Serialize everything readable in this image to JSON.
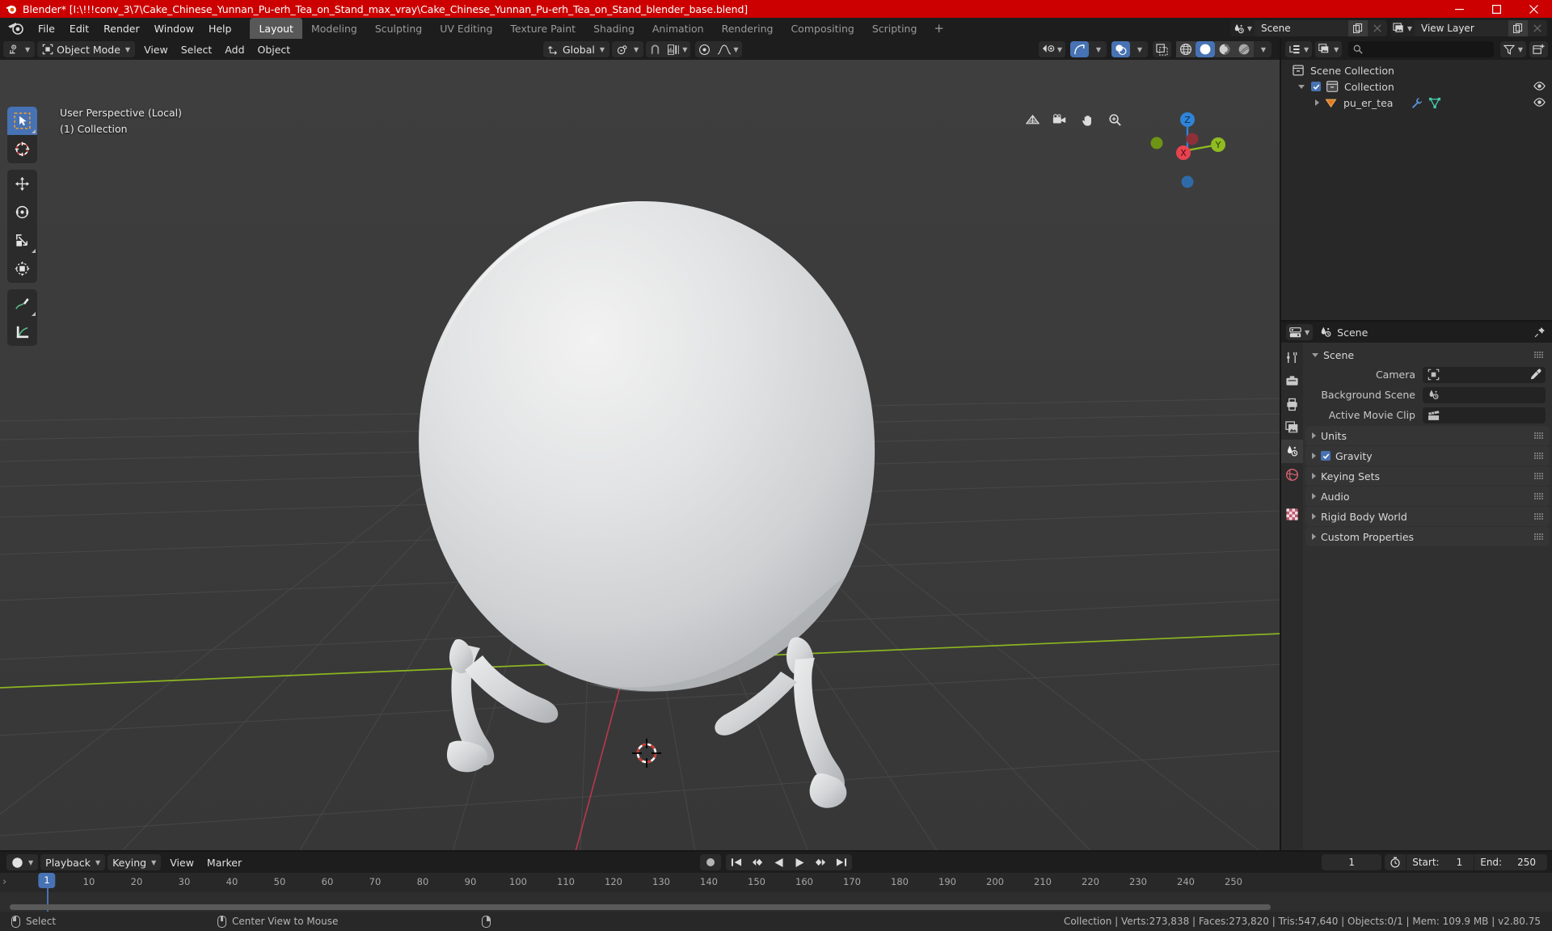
{
  "window": {
    "app_name": "Blender*",
    "title": "Blender* [I:\\!!!conv_3\\7\\Cake_Chinese_Yunnan_Pu-erh_Tea_on_Stand_max_vray\\Cake_Chinese_Yunnan_Pu-erh_Tea_on_Stand_blender_base.blend]",
    "titlebar_color": "#cc0000",
    "controls": {
      "minimize": "minimize-button",
      "maximize": "maximize-button",
      "close": "close-button"
    }
  },
  "topbar": {
    "menus": [
      "File",
      "Edit",
      "Render",
      "Window",
      "Help"
    ],
    "workspaces": [
      {
        "label": "Layout",
        "active": true
      },
      {
        "label": "Modeling",
        "active": false
      },
      {
        "label": "Sculpting",
        "active": false
      },
      {
        "label": "UV Editing",
        "active": false
      },
      {
        "label": "Texture Paint",
        "active": false
      },
      {
        "label": "Shading",
        "active": false
      },
      {
        "label": "Animation",
        "active": false
      },
      {
        "label": "Rendering",
        "active": false
      },
      {
        "label": "Compositing",
        "active": false
      },
      {
        "label": "Scripting",
        "active": false
      }
    ],
    "add_workspace": "+",
    "scene": {
      "label": "Scene"
    },
    "view_layer": {
      "label": "View Layer"
    }
  },
  "viewport": {
    "mode": "Object Mode",
    "menus": [
      "View",
      "Select",
      "Add",
      "Object"
    ],
    "transform_orientation": "Global",
    "overlay": {
      "line1": "User Perspective (Local)",
      "line2": "(1) Collection"
    },
    "shading_modes": [
      "wireframe",
      "solid",
      "material-preview",
      "rendered"
    ],
    "active_shading": "solid",
    "gizmo_axes": {
      "x": "X",
      "y": "Y",
      "z": "Z"
    },
    "accent_blue": "#4772b3",
    "axis_x_color": "#c1384f",
    "axis_y_color": "#8fbc1f",
    "background_color": "#3b3b3b"
  },
  "outliner": {
    "search_placeholder": "",
    "rows": [
      {
        "label": "Scene Collection",
        "indent": 0,
        "icon": "collection-icon",
        "has_eye": false,
        "has_checkbox": false,
        "has_disclosure": false
      },
      {
        "label": "Collection",
        "indent": 1,
        "icon": "collection-icon",
        "has_eye": true,
        "has_checkbox": true,
        "has_disclosure": true
      },
      {
        "label": "pu_er_tea",
        "indent": 2,
        "icon": "mesh-object-icon",
        "has_eye": true,
        "has_checkbox": false,
        "has_disclosure": true
      }
    ]
  },
  "properties": {
    "header_title": "Scene",
    "tabs": [
      "tool",
      "render",
      "output",
      "view-layer",
      "scene",
      "world",
      "object",
      "texture"
    ],
    "active_tab": "scene",
    "panels": [
      {
        "label": "Scene",
        "open": true,
        "checkbox": null
      },
      {
        "label": "Units",
        "open": false,
        "checkbox": null
      },
      {
        "label": "Gravity",
        "open": false,
        "checkbox": true
      },
      {
        "label": "Keying Sets",
        "open": false,
        "checkbox": null
      },
      {
        "label": "Audio",
        "open": false,
        "checkbox": null
      },
      {
        "label": "Rigid Body World",
        "open": false,
        "checkbox": null
      },
      {
        "label": "Custom Properties",
        "open": false,
        "checkbox": null
      }
    ],
    "scene_fields": [
      {
        "label": "Camera",
        "value": "",
        "icon": "camera-icon",
        "eyedropper": true
      },
      {
        "label": "Background Scene",
        "value": "",
        "icon": "scene-icon",
        "eyedropper": false
      },
      {
        "label": "Active Movie Clip",
        "value": "",
        "icon": "clip-icon",
        "eyedropper": false
      }
    ]
  },
  "timeline": {
    "editor_type": "timeline-editor",
    "menus": [
      "Playback",
      "Keying",
      "View",
      "Marker"
    ],
    "transport": [
      "jump-to-start",
      "prev-keyframe",
      "play-reverse",
      "play",
      "next-keyframe",
      "jump-to-end"
    ],
    "current_frame": "1",
    "start_label": "Start:",
    "start_value": "1",
    "end_label": "End:",
    "end_value": "250",
    "ruler_ticks": [
      "1",
      "10",
      "20",
      "30",
      "40",
      "50",
      "60",
      "70",
      "80",
      "90",
      "100",
      "110",
      "120",
      "130",
      "140",
      "150",
      "160",
      "170",
      "180",
      "190",
      "200",
      "210",
      "220",
      "230",
      "240",
      "250"
    ],
    "playhead_frame": "1"
  },
  "statusbar": {
    "left_items": [
      {
        "mouse": "left",
        "label": "Select"
      },
      {
        "mouse": "mid",
        "label": "Center View to Mouse"
      },
      {
        "mouse": "right",
        "label": ""
      }
    ],
    "stats": "Collection | Verts:273,838 | Faces:273,820 | Tris:547,640 | Objects:0/1 | Mem: 109.9 MB | v2.80.75"
  }
}
